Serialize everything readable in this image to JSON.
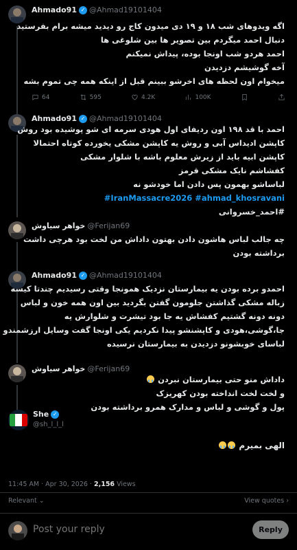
{
  "tweets": [
    {
      "name": "Ahmado91",
      "handle": "@Ahmad19101404",
      "verified": true,
      "lines": [
        "اگه ویدوهای شب ۱۸ و ۱۹ دی میدون کاج رو دیدید میشه برام بفرستید",
        "دنبال احمد میگردم بین تصویر ها بین شلوغی ها",
        "احمد هردو شب اونجا بوده، پیداش نمیکنم",
        "آخه گوشیشم دزدیدن",
        "میخوام اون لحظه های اخرشو ببینم قبل از اینکه همه چی تموم بشه"
      ],
      "actions": {
        "replies": "64",
        "reposts": "595",
        "likes": "4.2K",
        "views": "100K"
      }
    },
    {
      "name": "Ahmado91",
      "handle": "@Ahmad19101404",
      "verified": true,
      "lines": [
        "احمد با قد ۱۹۸ اون ردیفای اول هودی سرمه ای شو پوشیده بود روش",
        "کاپشن ادیداس آبی و روش یه کاپشن مشکی یخورده کوتاه احتمالا",
        "کاپشن ابیه باید از زیرش معلوم باشه با شلوار مشکی",
        "کفشاشم نایک مشکی قرمز",
        "لباساشو بهمون پس دادن اما خودشو نه",
        "#احمد_خسروانی"
      ],
      "hashtags": "#IranMassacre2026 #ahmad_khosravani"
    },
    {
      "name": "خواهر سیاوش",
      "handle": "@Ferijan69",
      "verified": false,
      "lines": [
        "چه جالب لباس هاشون دادن بهتون داداش من لخت بود هرچی داشت",
        "برداشته بودن"
      ]
    },
    {
      "name": "Ahmado91",
      "handle": "@Ahmad19101404",
      "verified": true,
      "lines": [
        "احمدو برده بودن یه بیمارستان نزدیک همونجا وقتی رسیدیم چندتا کیسه",
        "زباله مشکی گذاشتن جلومون گفتن بگردید بین اون همه خون و لباس",
        "دونه دونه گشتیم کفشاش یه جا بود تیشرت و شلوارش یه",
        "جا،گوشی،هودی و کاپشنشو پیدا نکردیم یکی اونجا گفت وسایل ارزشمندو",
        "لباسای خوبشونو دزدیدن به بیمارستان نرسیده"
      ]
    },
    {
      "name": "خواهر سیاوش",
      "handle": "@Ferijan69",
      "verified": false,
      "lines": [
        "داداش منو حتی بیمارستان نبردن",
        "و لخت لخت انداخته بودن کهریزک",
        "پول و گوشی و لباس و مدارک همرو برداشته بودن"
      ]
    },
    {
      "name": "She",
      "handle": "@sh_l_l_l",
      "verified": true,
      "lines": [
        "الهی بمیرم"
      ]
    }
  ],
  "meta": {
    "time": "11:45 AM · Apr 30, 2026 · ",
    "views_count": "2,156",
    "views_label": " Views"
  },
  "relevant": {
    "label": "Relevant ⌄",
    "view_quotes": "View quotes ›"
  },
  "reply": {
    "placeholder": "Post your reply",
    "button": "Reply"
  },
  "colors": {
    "accent": "#1d9bf0",
    "background": "#000000",
    "text": "#e7e9ea",
    "muted": "#71767b"
  }
}
